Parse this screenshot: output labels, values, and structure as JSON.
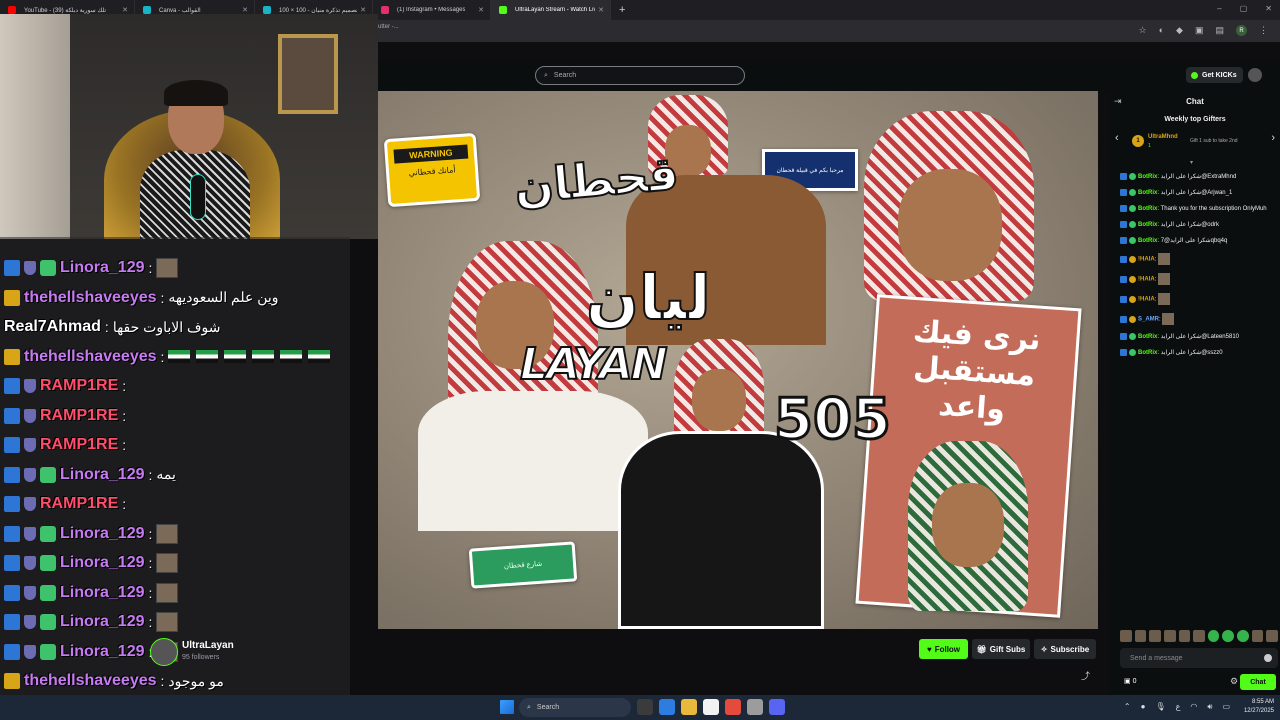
{
  "browser": {
    "tabs": [
      {
        "label": "YouTube - (39) تلك سورية دبلكة",
        "favicon_color": "#ff0000",
        "active": false
      },
      {
        "label": "Canva - القوالب",
        "favicon_color": "#17b3c6",
        "active": false
      },
      {
        "label": "تصميم تذكرة منيان - 100 × 100",
        "favicon_color": "#17b3c6",
        "active": false
      },
      {
        "label": "(1) Instagram • Messages",
        "favicon_color": "#e1306c",
        "active": false
      },
      {
        "label": "UltraLayan Stream - Watch Live",
        "favicon_color": "#53fc18",
        "active": true
      }
    ],
    "new_tab": "+",
    "url_fragment": "utter -...",
    "profile_initial": "R"
  },
  "kick": {
    "search_placeholder": "Search",
    "get_kicks": "Get KICKs"
  },
  "video": {
    "warning_title": "WARNING",
    "warning_sub": "أمانك قحطاني",
    "blue_sign": "مرحبا بكم في قبيلة قحطان",
    "green_sign": "شارع قحطان",
    "qahtan": "قحطان",
    "layan_ar": "ليان",
    "layan": "LAYAN",
    "number": "505",
    "poster_text": "نرى فيك مستقبل واعد"
  },
  "overlay": {
    "rows": [
      {
        "name": "Linora_129",
        "color": "#c77bf2",
        "badges": [
          "blue",
          "shield",
          "green"
        ],
        "message": "",
        "emote": true
      },
      {
        "name": "thehellshaveeyes",
        "color": "#c77bf2",
        "badges": [
          "crown"
        ],
        "message": "وين علم السعوديهه",
        "emote": false
      },
      {
        "name": "Real7Ahmad",
        "color": "#ffffff",
        "badges": [],
        "message": "شوف الاباوت حقها",
        "emote": false
      },
      {
        "name": "thehellshaveeyes",
        "color": "#c77bf2",
        "badges": [
          "crown"
        ],
        "message": "",
        "flags": 6,
        "emote": false
      },
      {
        "name": "RAMP1RE",
        "color": "#ff4d6b",
        "badges": [
          "blue",
          "shield"
        ],
        "message": "",
        "emote": false
      },
      {
        "name": "RAMP1RE",
        "color": "#ff4d6b",
        "badges": [
          "blue",
          "shield"
        ],
        "message": "",
        "emote": false
      },
      {
        "name": "RAMP1RE",
        "color": "#ff4d6b",
        "badges": [
          "blue",
          "shield"
        ],
        "message": "",
        "emote": false
      },
      {
        "name": "Linora_129",
        "color": "#c77bf2",
        "badges": [
          "blue",
          "shield",
          "green"
        ],
        "message": "يمه",
        "emote": false
      },
      {
        "name": "RAMP1RE",
        "color": "#ff4d6b",
        "badges": [
          "blue",
          "shield"
        ],
        "message": "",
        "emote": false
      },
      {
        "name": "Linora_129",
        "color": "#c77bf2",
        "badges": [
          "blue",
          "shield",
          "green"
        ],
        "message": "",
        "emote": true
      },
      {
        "name": "Linora_129",
        "color": "#c77bf2",
        "badges": [
          "blue",
          "shield",
          "green"
        ],
        "message": "",
        "emote": true
      },
      {
        "name": "Linora_129",
        "color": "#c77bf2",
        "badges": [
          "blue",
          "shield",
          "green"
        ],
        "message": "",
        "emote": true
      },
      {
        "name": "Linora_129",
        "color": "#c77bf2",
        "badges": [
          "blue",
          "shield",
          "green"
        ],
        "message": "",
        "emote": true
      },
      {
        "name": "Linora_129",
        "color": "#c77bf2",
        "badges": [
          "blue",
          "shield",
          "green"
        ],
        "message": "",
        "emote": true
      },
      {
        "name": "thehellshaveeyes",
        "color": "#c77bf2",
        "badges": [
          "crown"
        ],
        "message": "مو موجود",
        "emote": false
      }
    ]
  },
  "channel": {
    "name": "UltraLayan",
    "followers": "95 followers",
    "follow": "Follow",
    "gift_subs": "Gift Subs",
    "subscribe": "Subscribe"
  },
  "chat": {
    "title": "Chat",
    "gifters_title": "Weekly top Gifters",
    "top_gifter": "UltraMhnd",
    "top_gifter_rank": "1",
    "top_gifter_count": "1",
    "gift_hint": "Gift 1 sub to take 2nd",
    "messages": [
      {
        "name": "BotRix",
        "text": "شكرا على الرايد@ExtraMhnd"
      },
      {
        "name": "BotRix",
        "text": "شكرا على الرايد@Arjwan_1"
      },
      {
        "name": "BotRix",
        "text": "Thank you for the subscription OnlyMuh"
      },
      {
        "name": "BotRix",
        "text": "شكرا على الرايد@odrk"
      },
      {
        "name": "BotRix",
        "text": "شكرا على الرايد@7qbq4q"
      },
      {
        "name": "!HAIA",
        "text": "",
        "emote": true
      },
      {
        "name": "!HAIA",
        "text": "",
        "emote": true
      },
      {
        "name": "!HAIA",
        "text": "",
        "emote": true
      },
      {
        "name": "S_AMR",
        "text": "",
        "emote": true
      },
      {
        "name": "BotRix",
        "text": "شكرا على الرايد@Lateen5810"
      },
      {
        "name": "BotRix",
        "text": "شكرا على الرايد@sszz0"
      }
    ],
    "send_placeholder": "Send a message",
    "kicks_count": "0",
    "chat_button": "Chat"
  },
  "taskbar": {
    "search": "Search",
    "time": "8:55 AM",
    "date": "12/27/2025",
    "lang": "ع"
  }
}
